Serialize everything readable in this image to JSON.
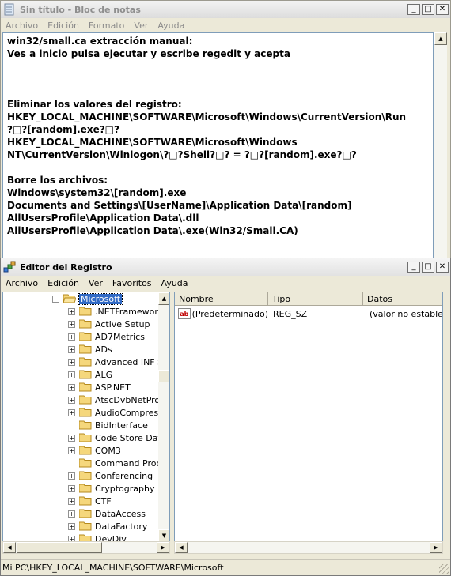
{
  "notepad": {
    "title": "Sin título - Bloc de notas",
    "menu": [
      "Archivo",
      "Edición",
      "Formato",
      "Ver",
      "Ayuda"
    ],
    "lines": [
      "win32/small.ca extracción manual:",
      "Ves a inicio pulsa ejecutar y escribe regedit y acepta",
      "",
      "",
      "",
      "Eliminar los valores del registro:",
      "HKEY_LOCAL_MACHINE\\SOFTWARE\\Microsoft\\Windows\\CurrentVersion\\Run",
      "?□?[random].exe?□?",
      "HKEY_LOCAL_MACHINE\\SOFTWARE\\Microsoft\\Windows",
      "NT\\CurrentVersion\\Winlogon\\?□?Shell?□? = ?□?[random].exe?□?",
      "",
      "Borre los archivos:",
      "Windows\\system32\\[random].exe",
      "Documents and Settings\\[UserName]\\Application Data\\[random]",
      "AllUsersProfile\\Application Data\\.dll",
      "AllUsersProfile\\Application Data\\.exe(Win32/Small.CA)"
    ]
  },
  "regedit": {
    "title": "Editor del Registro",
    "menu": [
      "Archivo",
      "Edición",
      "Ver",
      "Favoritos",
      "Ayuda"
    ],
    "tree": {
      "selected": "Microsoft",
      "children": [
        {
          "label": ".NETFramework",
          "expandable": true
        },
        {
          "label": "Active Setup",
          "expandable": true
        },
        {
          "label": "AD7Metrics",
          "expandable": true
        },
        {
          "label": "ADs",
          "expandable": true
        },
        {
          "label": "Advanced INF S",
          "expandable": true
        },
        {
          "label": "ALG",
          "expandable": true
        },
        {
          "label": "ASP.NET",
          "expandable": true
        },
        {
          "label": "AtscDvbNetProv",
          "expandable": true
        },
        {
          "label": "AudioCompressio",
          "expandable": true
        },
        {
          "label": "BidInterface",
          "expandable": false
        },
        {
          "label": "Code Store Data",
          "expandable": true
        },
        {
          "label": "COM3",
          "expandable": true
        },
        {
          "label": "Command Proce",
          "expandable": false
        },
        {
          "label": "Conferencing",
          "expandable": true
        },
        {
          "label": "Cryptography",
          "expandable": true
        },
        {
          "label": "CTF",
          "expandable": true
        },
        {
          "label": "DataAccess",
          "expandable": true
        },
        {
          "label": "DataFactory",
          "expandable": true
        },
        {
          "label": "DevDiv",
          "expandable": true
        }
      ]
    },
    "columns": [
      "Nombre",
      "Tipo",
      "Datos"
    ],
    "values": [
      {
        "name": "(Predeterminado)",
        "type": "REG_SZ",
        "data": "(valor no establecido)"
      }
    ],
    "status": "Mi PC\\HKEY_LOCAL_MACHINE\\SOFTWARE\\Microsoft"
  }
}
